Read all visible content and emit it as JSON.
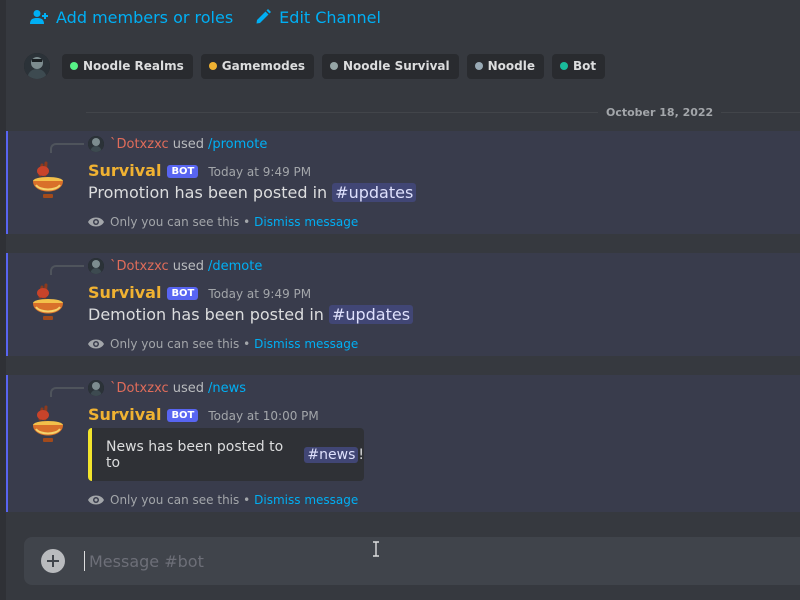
{
  "toolbar": {
    "add_members": "Add members or roles",
    "edit_channel": "Edit Channel"
  },
  "roles": [
    {
      "label": "Noodle Realms",
      "color": "#57f287"
    },
    {
      "label": "Gamemodes",
      "color": "#f0b232"
    },
    {
      "label": "Noodle Survival",
      "color": "#95a5a6"
    },
    {
      "label": "Noodle",
      "color": "#99aab5"
    },
    {
      "label": "Bot",
      "color": "#1abc9c"
    }
  ],
  "date_divider": "October 18, 2022",
  "messages": [
    {
      "reply_user": "`Dotxzxc",
      "reply_used": "used",
      "reply_command": "/promote",
      "username": "Survival",
      "badge": "BOT",
      "time": "Today at 9:49 PM",
      "text": "Promotion has been posted in",
      "mention": "updates",
      "ephemeral_note": "Only you can see this •",
      "dismiss": "Dismiss message"
    },
    {
      "reply_user": "`Dotxzxc",
      "reply_used": "used",
      "reply_command": "/demote",
      "username": "Survival",
      "badge": "BOT",
      "time": "Today at 9:49 PM",
      "text": "Demotion has been posted in",
      "mention": "updates",
      "ephemeral_note": "Only you can see this •",
      "dismiss": "Dismiss message"
    },
    {
      "reply_user": "`Dotxzxc",
      "reply_used": "used",
      "reply_command": "/news",
      "username": "Survival",
      "badge": "BOT",
      "time": "Today at 10:00 PM",
      "embed_text": "News has been posted to to",
      "embed_mention": "news",
      "embed_suffix": "!",
      "ephemeral_note": "Only you can see this •",
      "dismiss": "Dismiss message"
    }
  ],
  "composer": {
    "placeholder": "Message #bot"
  },
  "colors": {
    "accent": "#5865f2",
    "link": "#00aff4",
    "bot_name": "#f0b232",
    "embed_bar": "#f2e42c"
  }
}
